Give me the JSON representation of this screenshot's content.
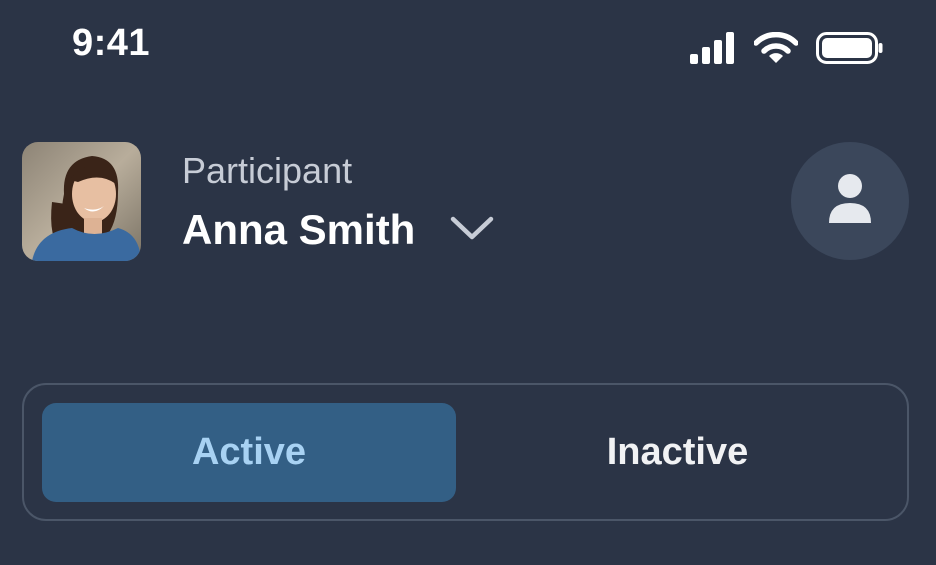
{
  "status_bar": {
    "time": "9:41",
    "icons": [
      "cellular-signal-icon",
      "wifi-icon",
      "battery-icon"
    ]
  },
  "header": {
    "avatar_icon": "participant-photo",
    "label": "Participant",
    "name": "Anna Smith",
    "dropdown_icon": "chevron-down-icon",
    "profile_icon": "person-icon"
  },
  "segmented_control": {
    "options": [
      {
        "label": "Active",
        "selected": true
      },
      {
        "label": "Inactive",
        "selected": false
      }
    ]
  },
  "colors": {
    "background": "#2b3446",
    "active_segment": "#335f85",
    "active_text": "#a8d2f3",
    "border": "#4b5668",
    "profile_button": "#3b475b"
  }
}
